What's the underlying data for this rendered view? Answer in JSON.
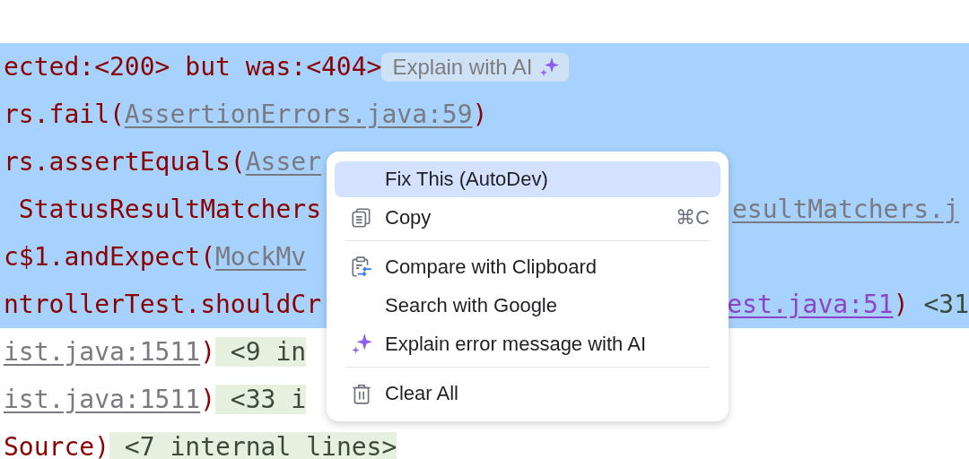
{
  "console": {
    "lines": [
      {
        "selected": true,
        "left": [
          {
            "kind": "text",
            "text": "ected:<200> but was:<404>"
          },
          {
            "kind": "ai_badge",
            "text": "Explain with AI"
          }
        ]
      },
      {
        "selected": true,
        "left": [
          {
            "kind": "text",
            "text": "rs.fail("
          },
          {
            "kind": "link",
            "text": "AssertionErrors.java:59"
          },
          {
            "kind": "text",
            "text": ")"
          }
        ]
      },
      {
        "selected": true,
        "left": [
          {
            "kind": "text",
            "text": "rs.assertEquals("
          },
          {
            "kind": "link",
            "text": "Asser"
          }
        ]
      },
      {
        "selected": true,
        "left": [
          {
            "kind": "text",
            "text": " StatusResultMatchers"
          }
        ],
        "right": [
          {
            "kind": "link",
            "text": "esultMatchers.j"
          }
        ]
      },
      {
        "selected": true,
        "left": [
          {
            "kind": "text",
            "text": "c$1.andExpect("
          },
          {
            "kind": "link",
            "text": "MockMv"
          }
        ]
      },
      {
        "selected": true,
        "left": [
          {
            "kind": "text",
            "text": "ntrollerTest.shouldCr"
          }
        ],
        "right": [
          {
            "kind": "visited_link",
            "text": "est.java:51"
          },
          {
            "kind": "text",
            "text": ")"
          },
          {
            "kind": "plain",
            "text": " <31"
          }
        ]
      },
      {
        "selected": false,
        "left": [
          {
            "kind": "link",
            "text": "ist.java:1511"
          },
          {
            "kind": "text",
            "text": ")"
          },
          {
            "kind": "fold",
            "text": " <9 in"
          }
        ]
      },
      {
        "selected": false,
        "left": [
          {
            "kind": "link",
            "text": "ist.java:1511"
          },
          {
            "kind": "text",
            "text": ")"
          },
          {
            "kind": "fold",
            "text": " <33 i"
          }
        ]
      },
      {
        "selected": false,
        "left": [
          {
            "kind": "text",
            "text": "Source)"
          },
          {
            "kind": "fold",
            "text": " <7 internal lines>"
          }
        ]
      }
    ]
  },
  "context_menu": {
    "items": [
      {
        "kind": "item",
        "label": "Fix This (AutoDev)",
        "selected": true
      },
      {
        "kind": "item",
        "label": "Copy",
        "shortcut": "⌘C",
        "selected": false
      },
      {
        "kind": "separator"
      },
      {
        "kind": "item",
        "label": "Compare with Clipboard",
        "selected": false
      },
      {
        "kind": "item",
        "label": "Search with Google",
        "selected": false
      },
      {
        "kind": "item",
        "label": "Explain error message with AI",
        "selected": false
      },
      {
        "kind": "separator"
      },
      {
        "kind": "item",
        "label": "Clear All",
        "selected": false
      }
    ]
  }
}
